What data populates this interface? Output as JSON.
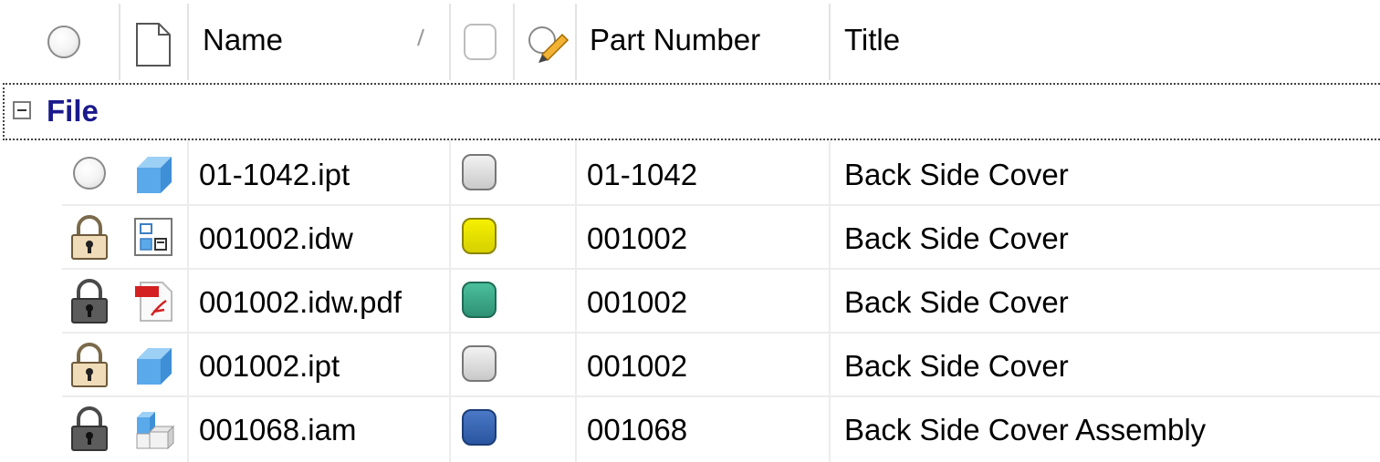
{
  "header": {
    "name_label": "Name",
    "part_number_label": "Part Number",
    "title_label": "Title"
  },
  "group": {
    "label": "File"
  },
  "rows": [
    {
      "status": "radio-empty",
      "filetype": "part-icon",
      "name": "01-1042.ipt",
      "state_color": "#d9d9d9",
      "part_number": "01-1042",
      "title": "Back Side Cover"
    },
    {
      "status": "lock-open-icon",
      "filetype": "drawing-icon",
      "name": "001002.idw",
      "state_color": "#e6e600",
      "part_number": "001002",
      "title": "Back Side Cover"
    },
    {
      "status": "lock-closed-icon",
      "filetype": "pdf-icon",
      "name": "001002.idw.pdf",
      "state_color": "#3aa88a",
      "part_number": "001002",
      "title": "Back Side Cover"
    },
    {
      "status": "lock-open-icon",
      "filetype": "part-icon",
      "name": "001002.ipt",
      "state_color": "#d9d9d9",
      "part_number": "001002",
      "title": "Back Side Cover"
    },
    {
      "status": "lock-closed-icon",
      "filetype": "assembly-icon",
      "name": "001068.iam",
      "state_color": "#3a66b0",
      "part_number": "001068",
      "title": "Back Side Cover Assembly"
    }
  ]
}
